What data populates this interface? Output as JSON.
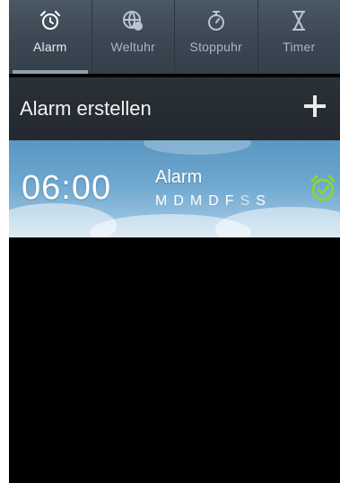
{
  "tabs": [
    {
      "label": "Alarm",
      "icon": "alarm-clock-icon",
      "active": true
    },
    {
      "label": "Weltuhr",
      "icon": "globe-icon",
      "active": false
    },
    {
      "label": "Stoppuhr",
      "icon": "stopwatch-icon",
      "active": false
    },
    {
      "label": "Timer",
      "icon": "hourglass-icon",
      "active": false
    }
  ],
  "create_bar": {
    "label": "Alarm erstellen",
    "add_icon": "plus-icon"
  },
  "alarms": [
    {
      "time": "06:00",
      "name": "Alarm",
      "days": [
        "M",
        "D",
        "M",
        "D",
        "F",
        "S",
        "S"
      ],
      "enabled": true,
      "toggle_color": "#8ad43a"
    }
  ]
}
